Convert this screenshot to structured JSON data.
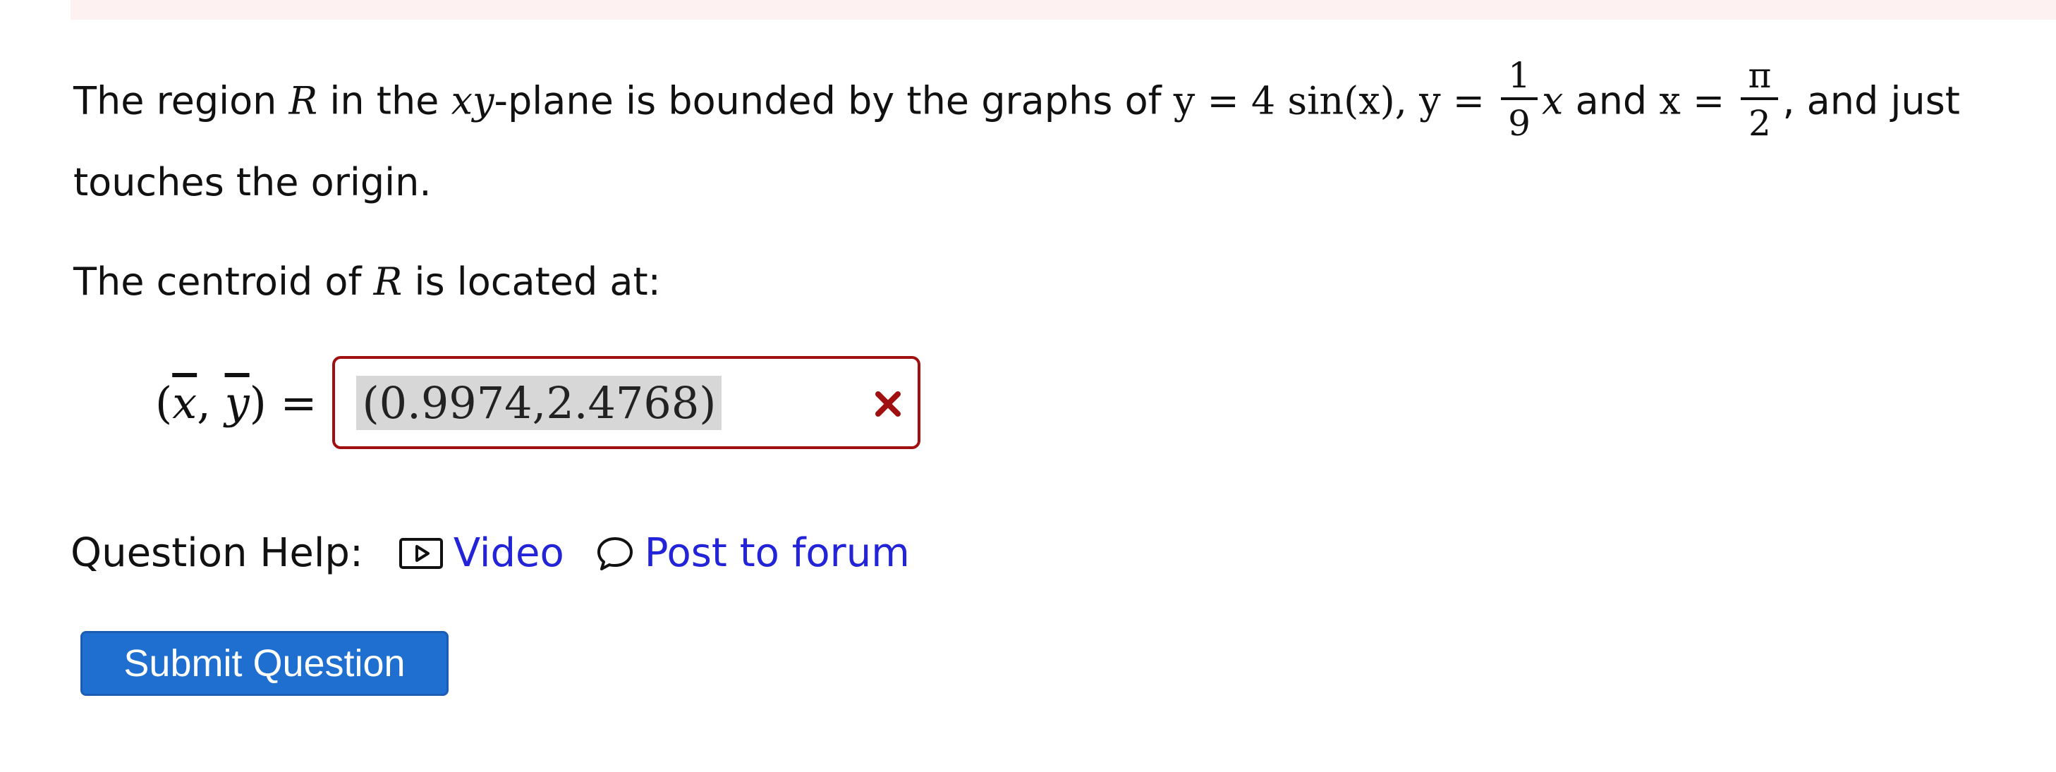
{
  "problem": {
    "part1": "The region ",
    "var_R": "R",
    "part2": " in the ",
    "var_xy": "xy",
    "part3": "-plane is bounded by the graphs of ",
    "eq1": "y = 4 sin(x),",
    "eq2_lhs": "y =",
    "frac1_num": "1",
    "frac1_den": "9",
    "eq2_rhs": "x",
    "part4": " and ",
    "eq3_lhs": "x =",
    "frac2_num": "π",
    "frac2_den": "2",
    "part5": ", and just touches the origin."
  },
  "centroid_prompt": {
    "part1": "The centroid of ",
    "var_R": "R",
    "part2": " is located at:"
  },
  "answer": {
    "label_open": "(",
    "x_bar": "x",
    "comma": ", ",
    "y_bar": "y",
    "label_close": ") =",
    "value": "(0.9974,2.4768)",
    "status": "incorrect",
    "status_color": "#a01010"
  },
  "help": {
    "label": "Question Help:",
    "video_label": "Video",
    "forum_label": "Post to forum",
    "video_icon": "video-icon",
    "forum_icon": "speech-bubble-icon"
  },
  "submit": {
    "label": "Submit Question",
    "color": "#1f6fd1"
  }
}
